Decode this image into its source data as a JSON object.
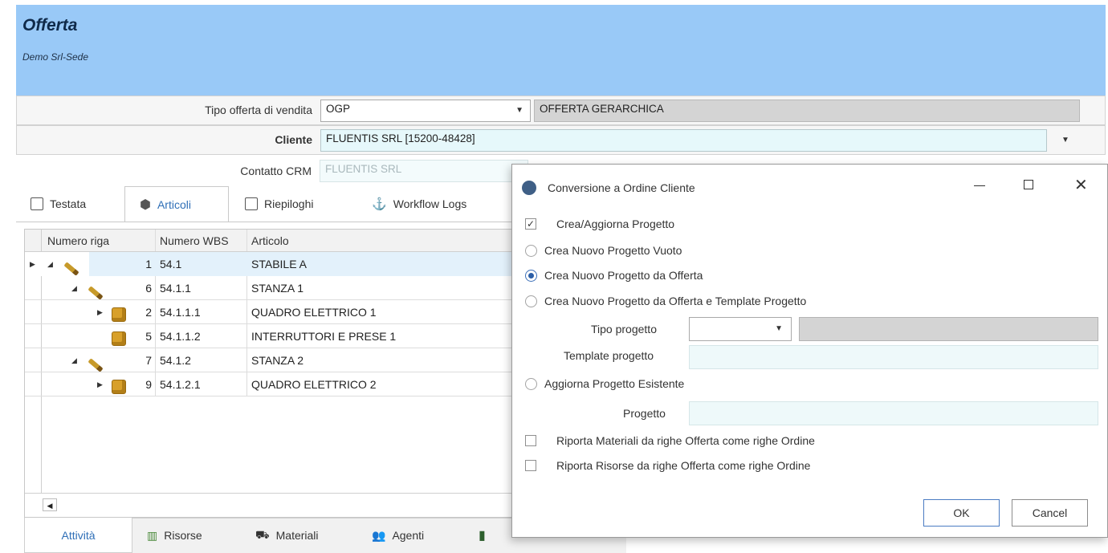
{
  "header": {
    "title": "Offerta",
    "subtitle": "Demo Srl-Sede"
  },
  "form": {
    "tipo_offerta": {
      "label": "Tipo offerta di vendita",
      "value": "OGP",
      "description": "OFFERTA GERARCHICA"
    },
    "cliente": {
      "label": "Cliente",
      "value": "FLUENTIS SRL [15200-48428]"
    },
    "contatto": {
      "label": "Contatto CRM",
      "value": "FLUENTIS SRL"
    }
  },
  "tabs_top": [
    {
      "label": "Testata",
      "icon": "document-icon"
    },
    {
      "label": "Articoli",
      "icon": "box-icon"
    },
    {
      "label": "Riepiloghi",
      "icon": "document-icon"
    },
    {
      "label": "Workflow Logs",
      "icon": "workflow-icon"
    }
  ],
  "grid": {
    "columns": [
      "Numero riga",
      "Numero WBS",
      "Articolo"
    ],
    "rows": [
      {
        "num": "1",
        "wbs": "54.1",
        "articolo": "STABILE A",
        "icon": "pencil-icon"
      },
      {
        "num": "6",
        "wbs": "54.1.1",
        "articolo": "STANZA 1",
        "icon": "pencil-icon"
      },
      {
        "num": "2",
        "wbs": "54.1.1.1",
        "articolo": "QUADRO ELETTRICO 1",
        "icon": "cube-icon"
      },
      {
        "num": "5",
        "wbs": "54.1.1.2",
        "articolo": "INTERRUTTORI E PRESE 1",
        "icon": "cube-icon"
      },
      {
        "num": "7",
        "wbs": "54.1.2",
        "articolo": "STANZA 2",
        "icon": "pencil-icon"
      },
      {
        "num": "9",
        "wbs": "54.1.2.1",
        "articolo": "QUADRO ELETTRICO 2",
        "icon": "cube-icon"
      }
    ]
  },
  "tabs_bottom": [
    {
      "label": "Attività",
      "icon": ""
    },
    {
      "label": "Risorse",
      "icon": "resources-icon"
    },
    {
      "label": "Materiali",
      "icon": "materials-icon"
    },
    {
      "label": "Agenti",
      "icon": "agents-icon"
    }
  ],
  "dialog": {
    "title": "Conversione a Ordine Cliente",
    "crea_aggiorna": "Crea/Aggiorna Progetto",
    "options": [
      "Crea Nuovo Progetto Vuoto",
      "Crea Nuovo Progetto da Offerta",
      "Crea Nuovo Progetto da Offerta e Template Progetto",
      "Aggiorna Progetto Esistente"
    ],
    "selected_option": "Crea Nuovo Progetto da Offerta",
    "tipo_progetto_label": "Tipo progetto",
    "template_progetto_label": "Template progetto",
    "progetto_label": "Progetto",
    "riporta_materiali": "Riporta Materiali da righe Offerta come righe Ordine",
    "riporta_risorse": "Riporta Risorse da righe Offerta come righe Ordine",
    "ok": "OK",
    "cancel": "Cancel"
  }
}
